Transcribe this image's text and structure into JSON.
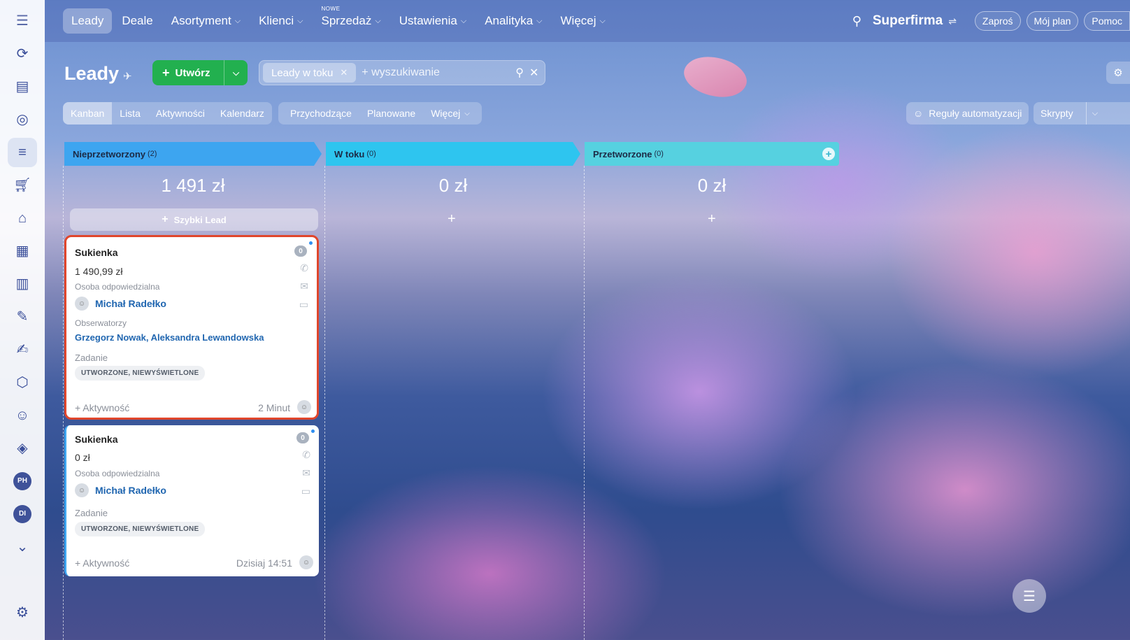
{
  "nav": {
    "items": [
      {
        "label": "Leady",
        "chevron": false,
        "badge": ""
      },
      {
        "label": "Deale",
        "chevron": false,
        "badge": ""
      },
      {
        "label": "Asortyment",
        "chevron": true,
        "badge": ""
      },
      {
        "label": "Klienci",
        "chevron": true,
        "badge": ""
      },
      {
        "label": "Sprzedaż",
        "chevron": true,
        "badge": "NOWE"
      },
      {
        "label": "Ustawienia",
        "chevron": true,
        "badge": ""
      },
      {
        "label": "Analityka",
        "chevron": true,
        "badge": ""
      },
      {
        "label": "Więcej",
        "chevron": true,
        "badge": ""
      }
    ],
    "brand": "Superfirma",
    "invite": "Zaproś",
    "plan": "Mój plan",
    "help": "Pomoc"
  },
  "rail": {
    "avatars": [
      "PH",
      "DI"
    ]
  },
  "header": {
    "title": "Leady",
    "create_label": "Utwórz",
    "filter_chip": "Leady w toku",
    "search_placeholder": "+ wyszukiwanie"
  },
  "views": [
    "Kanban",
    "Lista",
    "Aktywności",
    "Kalendarz"
  ],
  "filters": [
    "Przychodzące",
    "Planowane",
    "Więcej"
  ],
  "automation_label": "Reguły automatyzacji",
  "scripts_label": "Skrypty",
  "columns": [
    {
      "name": "Nieprzetworzony",
      "count": "(2)",
      "sum": "1 491 zł",
      "color": "#3da5f0"
    },
    {
      "name": "W toku",
      "count": "(0)",
      "sum": "0 zł",
      "color": "#2ec5ef"
    },
    {
      "name": "Przetworzone",
      "count": "(0)",
      "sum": "0 zł",
      "color": "#56d1e0"
    }
  ],
  "quick_lead_label": "Szybki Lead",
  "cards": [
    {
      "title": "Sukienka",
      "price": "1 490,99 zł",
      "responsible_label": "Osoba odpowiedzialna",
      "responsible": "Michał Radełko",
      "observers_label": "Obserwatorzy",
      "observers": "Grzegorz Nowak, Aleksandra Lewandowska",
      "task_label": "Zadanie",
      "task_status": "UTWORZONE, NIEWYŚWIETLONE",
      "activity": "+ Aktywność",
      "time": "2 Minut",
      "count": "0"
    },
    {
      "title": "Sukienka",
      "price": "0 zł",
      "responsible_label": "Osoba odpowiedzialna",
      "responsible": "Michał Radełko",
      "task_label": "Zadanie",
      "task_status": "UTWORZONE, NIEWYŚWIETLONE",
      "activity": "+ Aktywność",
      "time": "Dzisiaj 14:51",
      "count": "0"
    }
  ],
  "colors": {
    "create": "#22b04f",
    "highlight": "#e0462c",
    "link": "#2066b0"
  }
}
